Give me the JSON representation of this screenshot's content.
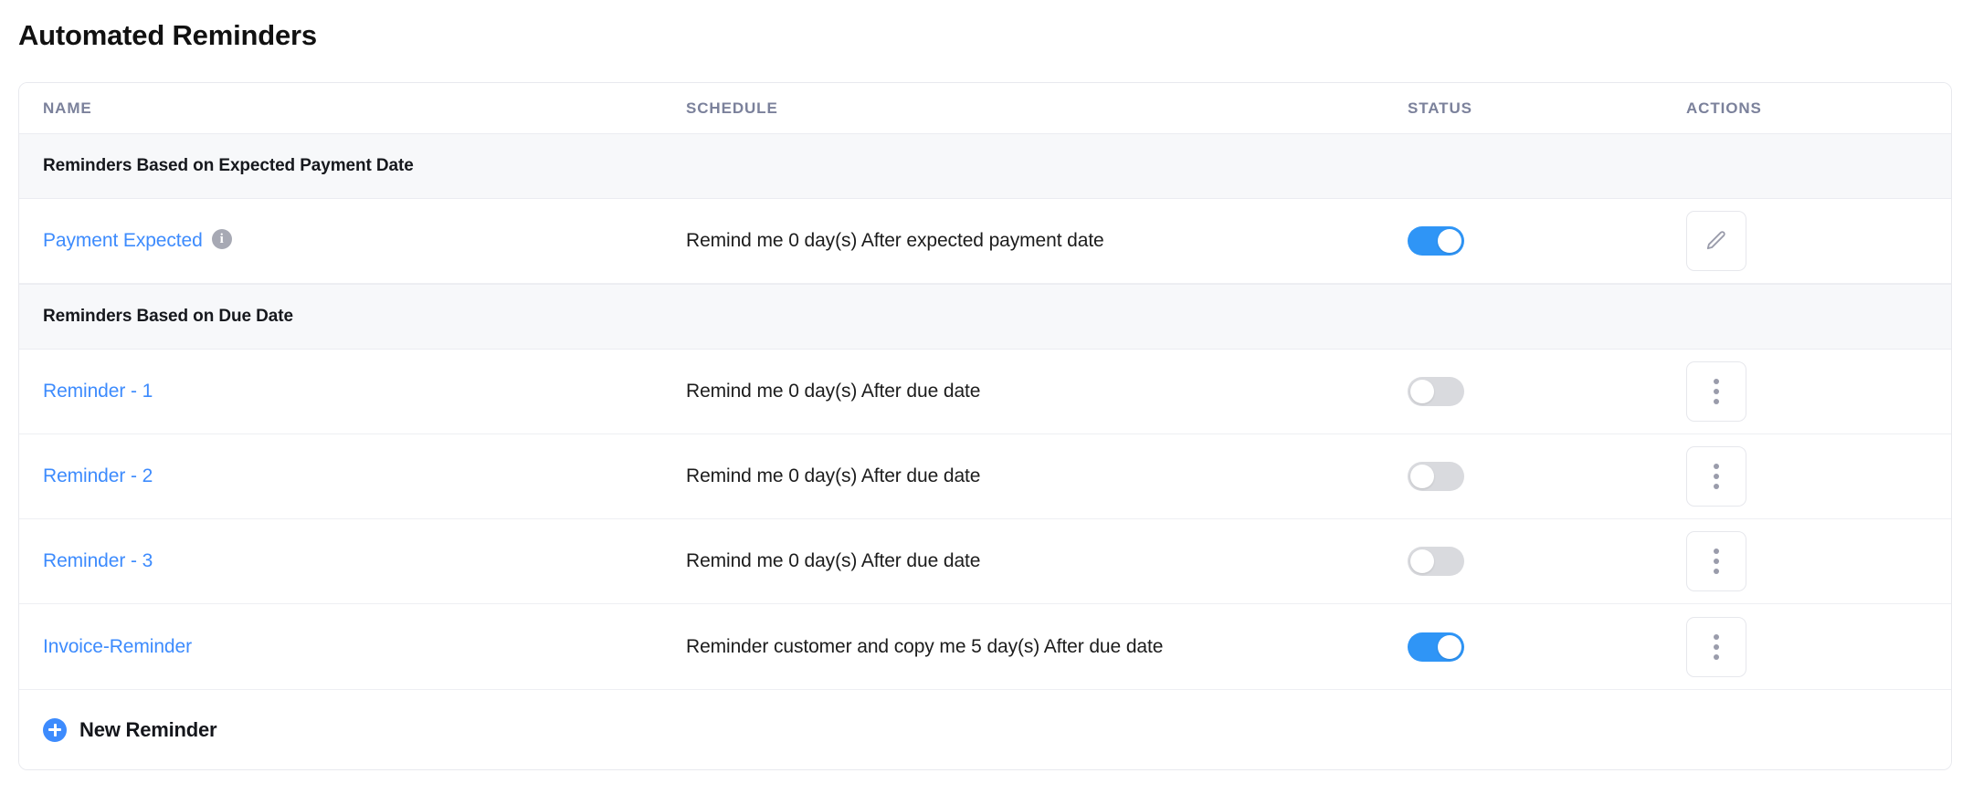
{
  "page_title": "Automated Reminders",
  "table": {
    "columns": [
      {
        "key": "name",
        "label": "NAME"
      },
      {
        "key": "schedule",
        "label": "SCHEDULE"
      },
      {
        "key": "status",
        "label": "STATUS"
      },
      {
        "key": "actions",
        "label": "ACTIONS"
      }
    ],
    "groups": [
      {
        "title": "Reminders Based on Expected Payment Date",
        "rows": [
          {
            "name": "Payment Expected",
            "info_icon": "info-icon",
            "info_glyph": "i",
            "schedule": "Remind me 0 day(s) After expected payment date",
            "status": "on",
            "action_icon": "pencil-icon"
          }
        ]
      },
      {
        "title": "Reminders Based on Due Date",
        "rows": [
          {
            "name": "Reminder - 1",
            "schedule": "Remind me 0 day(s) After due date",
            "status": "off",
            "action_icon": "kebab-menu-icon"
          },
          {
            "name": "Reminder - 2",
            "schedule": "Remind me 0 day(s) After due date",
            "status": "off",
            "action_icon": "kebab-menu-icon"
          },
          {
            "name": "Reminder - 3",
            "schedule": "Remind me 0 day(s) After due date",
            "status": "off",
            "action_icon": "kebab-menu-icon"
          },
          {
            "name": "Invoice-Reminder",
            "schedule": "Reminder customer and copy me 5 day(s) After due date",
            "status": "on",
            "action_icon": "kebab-menu-icon"
          }
        ]
      }
    ]
  },
  "footer": {
    "new_reminder_label": "New Reminder",
    "plus_icon": "plus-circle-icon"
  },
  "colors": {
    "link": "#3d8bfd",
    "toggle_on": "#2f95f6",
    "toggle_off": "#d9dade",
    "group_header_bg": "#f7f8fa",
    "header_text": "#7b819b",
    "border": "#e8e9ee"
  }
}
